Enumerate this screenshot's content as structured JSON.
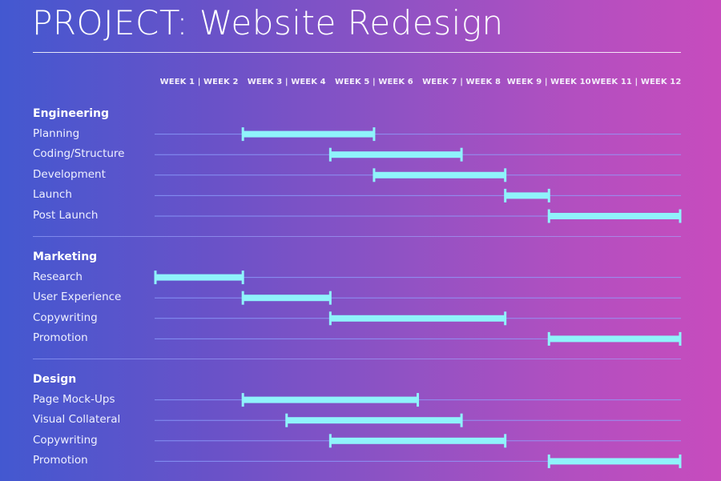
{
  "chart_data": {
    "type": "gantt",
    "title": "PROJECT: Website Redesign",
    "x_unit": "week",
    "xlim": [
      0,
      12
    ],
    "column_headers": [
      "WEEK 1 | WEEK 2",
      "WEEK 3 | WEEK 4",
      "WEEK 5 | WEEK 6",
      "WEEK 7 | WEEK 8",
      "WEEK 9 | WEEK 10",
      "WEEK 11 | WEEK 12"
    ],
    "groups": [
      {
        "name": "Engineering",
        "tasks": [
          {
            "name": "Planning",
            "start": 2,
            "end": 5
          },
          {
            "name": "Coding/Structure",
            "start": 4,
            "end": 7
          },
          {
            "name": "Development",
            "start": 5,
            "end": 8
          },
          {
            "name": "Launch",
            "start": 8,
            "end": 9
          },
          {
            "name": "Post Launch",
            "start": 9,
            "end": 12
          }
        ]
      },
      {
        "name": "Marketing",
        "tasks": [
          {
            "name": "Research",
            "start": 0,
            "end": 2
          },
          {
            "name": "User Experience",
            "start": 2,
            "end": 4
          },
          {
            "name": "Copywriting",
            "start": 4,
            "end": 8
          },
          {
            "name": "Promotion",
            "start": 9,
            "end": 12
          }
        ]
      },
      {
        "name": "Design",
        "tasks": [
          {
            "name": "Page Mock-Ups",
            "start": 2,
            "end": 6
          },
          {
            "name": "Visual Collateral",
            "start": 3,
            "end": 7
          },
          {
            "name": "Copywriting",
            "start": 4,
            "end": 8
          },
          {
            "name": "Promotion",
            "start": 9,
            "end": 12
          }
        ]
      }
    ],
    "colors": {
      "bar": "#8ff3fb",
      "track": "#8fa2ff",
      "background_start": "#4358d0",
      "background_end": "#c74cbd"
    }
  }
}
